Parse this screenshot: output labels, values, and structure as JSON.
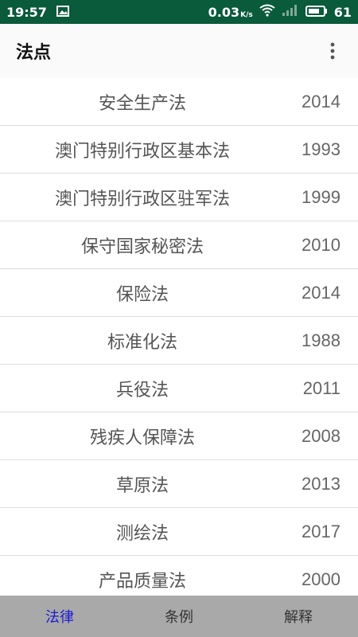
{
  "status_bar": {
    "time": "19:57",
    "net_speed": "0.03",
    "net_speed_unit": "K/s",
    "battery": "61"
  },
  "app_bar": {
    "title": "法点"
  },
  "laws": [
    {
      "name": "安全生产法",
      "year": "2014"
    },
    {
      "name": "澳门特别行政区基本法",
      "year": "1993"
    },
    {
      "name": "澳门特别行政区驻军法",
      "year": "1999"
    },
    {
      "name": "保守国家秘密法",
      "year": "2010"
    },
    {
      "name": "保险法",
      "year": "2014"
    },
    {
      "name": "标准化法",
      "year": "1988"
    },
    {
      "name": "兵役法",
      "year": "2011"
    },
    {
      "name": "残疾人保障法",
      "year": "2008"
    },
    {
      "name": "草原法",
      "year": "2013"
    },
    {
      "name": "测绘法",
      "year": "2017"
    },
    {
      "name": "产品质量法",
      "year": "2000"
    }
  ],
  "bottom_nav": {
    "tabs": [
      {
        "label": "法律"
      },
      {
        "label": "条例"
      },
      {
        "label": "解释"
      }
    ]
  },
  "colors": {
    "status_bar": "#0a5a3c",
    "app_bar": "#fafafa",
    "bottom_nav": "#a9a9a9",
    "active_tab": "#1a1ad6"
  }
}
